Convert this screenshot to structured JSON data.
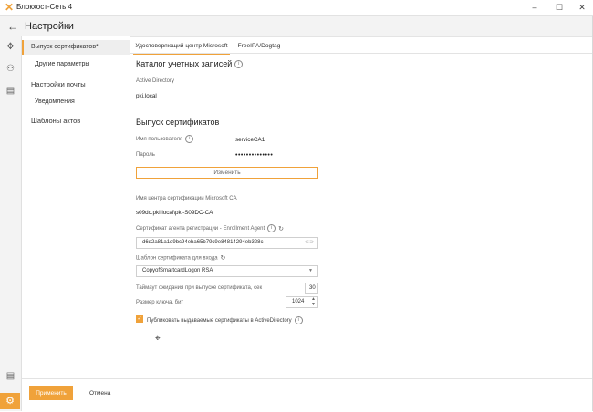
{
  "window": {
    "title": "Блокхост-Сеть 4",
    "controls": [
      "–",
      "☐",
      "✕"
    ]
  },
  "header": {
    "title": "Настройки"
  },
  "nav": {
    "items": [
      {
        "label": "Выпуск сертификатов*",
        "active": true
      },
      {
        "label": "Другие параметры"
      },
      {
        "label": "Настройки почты"
      },
      {
        "label": "Уведомления"
      },
      {
        "label": "Шаблоны актов"
      }
    ]
  },
  "tabs": [
    {
      "label": "Удостоверяющий центр Microsoft",
      "active": true
    },
    {
      "label": "FreeIPA/Dogtag"
    }
  ],
  "catalog": {
    "heading": "Каталог учетных записей",
    "type_label": "Active Directory",
    "domain": "pki.local"
  },
  "issue": {
    "heading": "Выпуск сертификатов",
    "username_label": "Имя пользователя",
    "username_value": "serviceCA1",
    "password_label": "Пароль",
    "password_value": "••••••••••••••",
    "change_button": "Изменить",
    "ca_name_label": "Имя центра сертификации Microsoft CA",
    "ca_name_value": "s09dc.pki.local\\pki-S09DC-CA",
    "agent_cert_label": "Сертификат агента регистрации - Enrollment Agent",
    "agent_cert_value": "d6d2a81a1d9bc94eba65b79c9e84814294eb328c",
    "template_label": "Шаблон сертификата для входа",
    "template_value": "CopyofSmartcardLogon RSA",
    "timeout_label": "Таймаут ожидания при выпуске сертификата, сек",
    "timeout_value": "30",
    "keysize_label": "Размер ключа, бит",
    "keysize_value": "1024",
    "publish_label": "Публиковать выдаваемые сертификаты в ActiveDirectory",
    "publish_checked": true
  },
  "footer": {
    "apply": "Применить",
    "cancel": "Отмена"
  },
  "colors": {
    "accent": "#f0a23a"
  }
}
